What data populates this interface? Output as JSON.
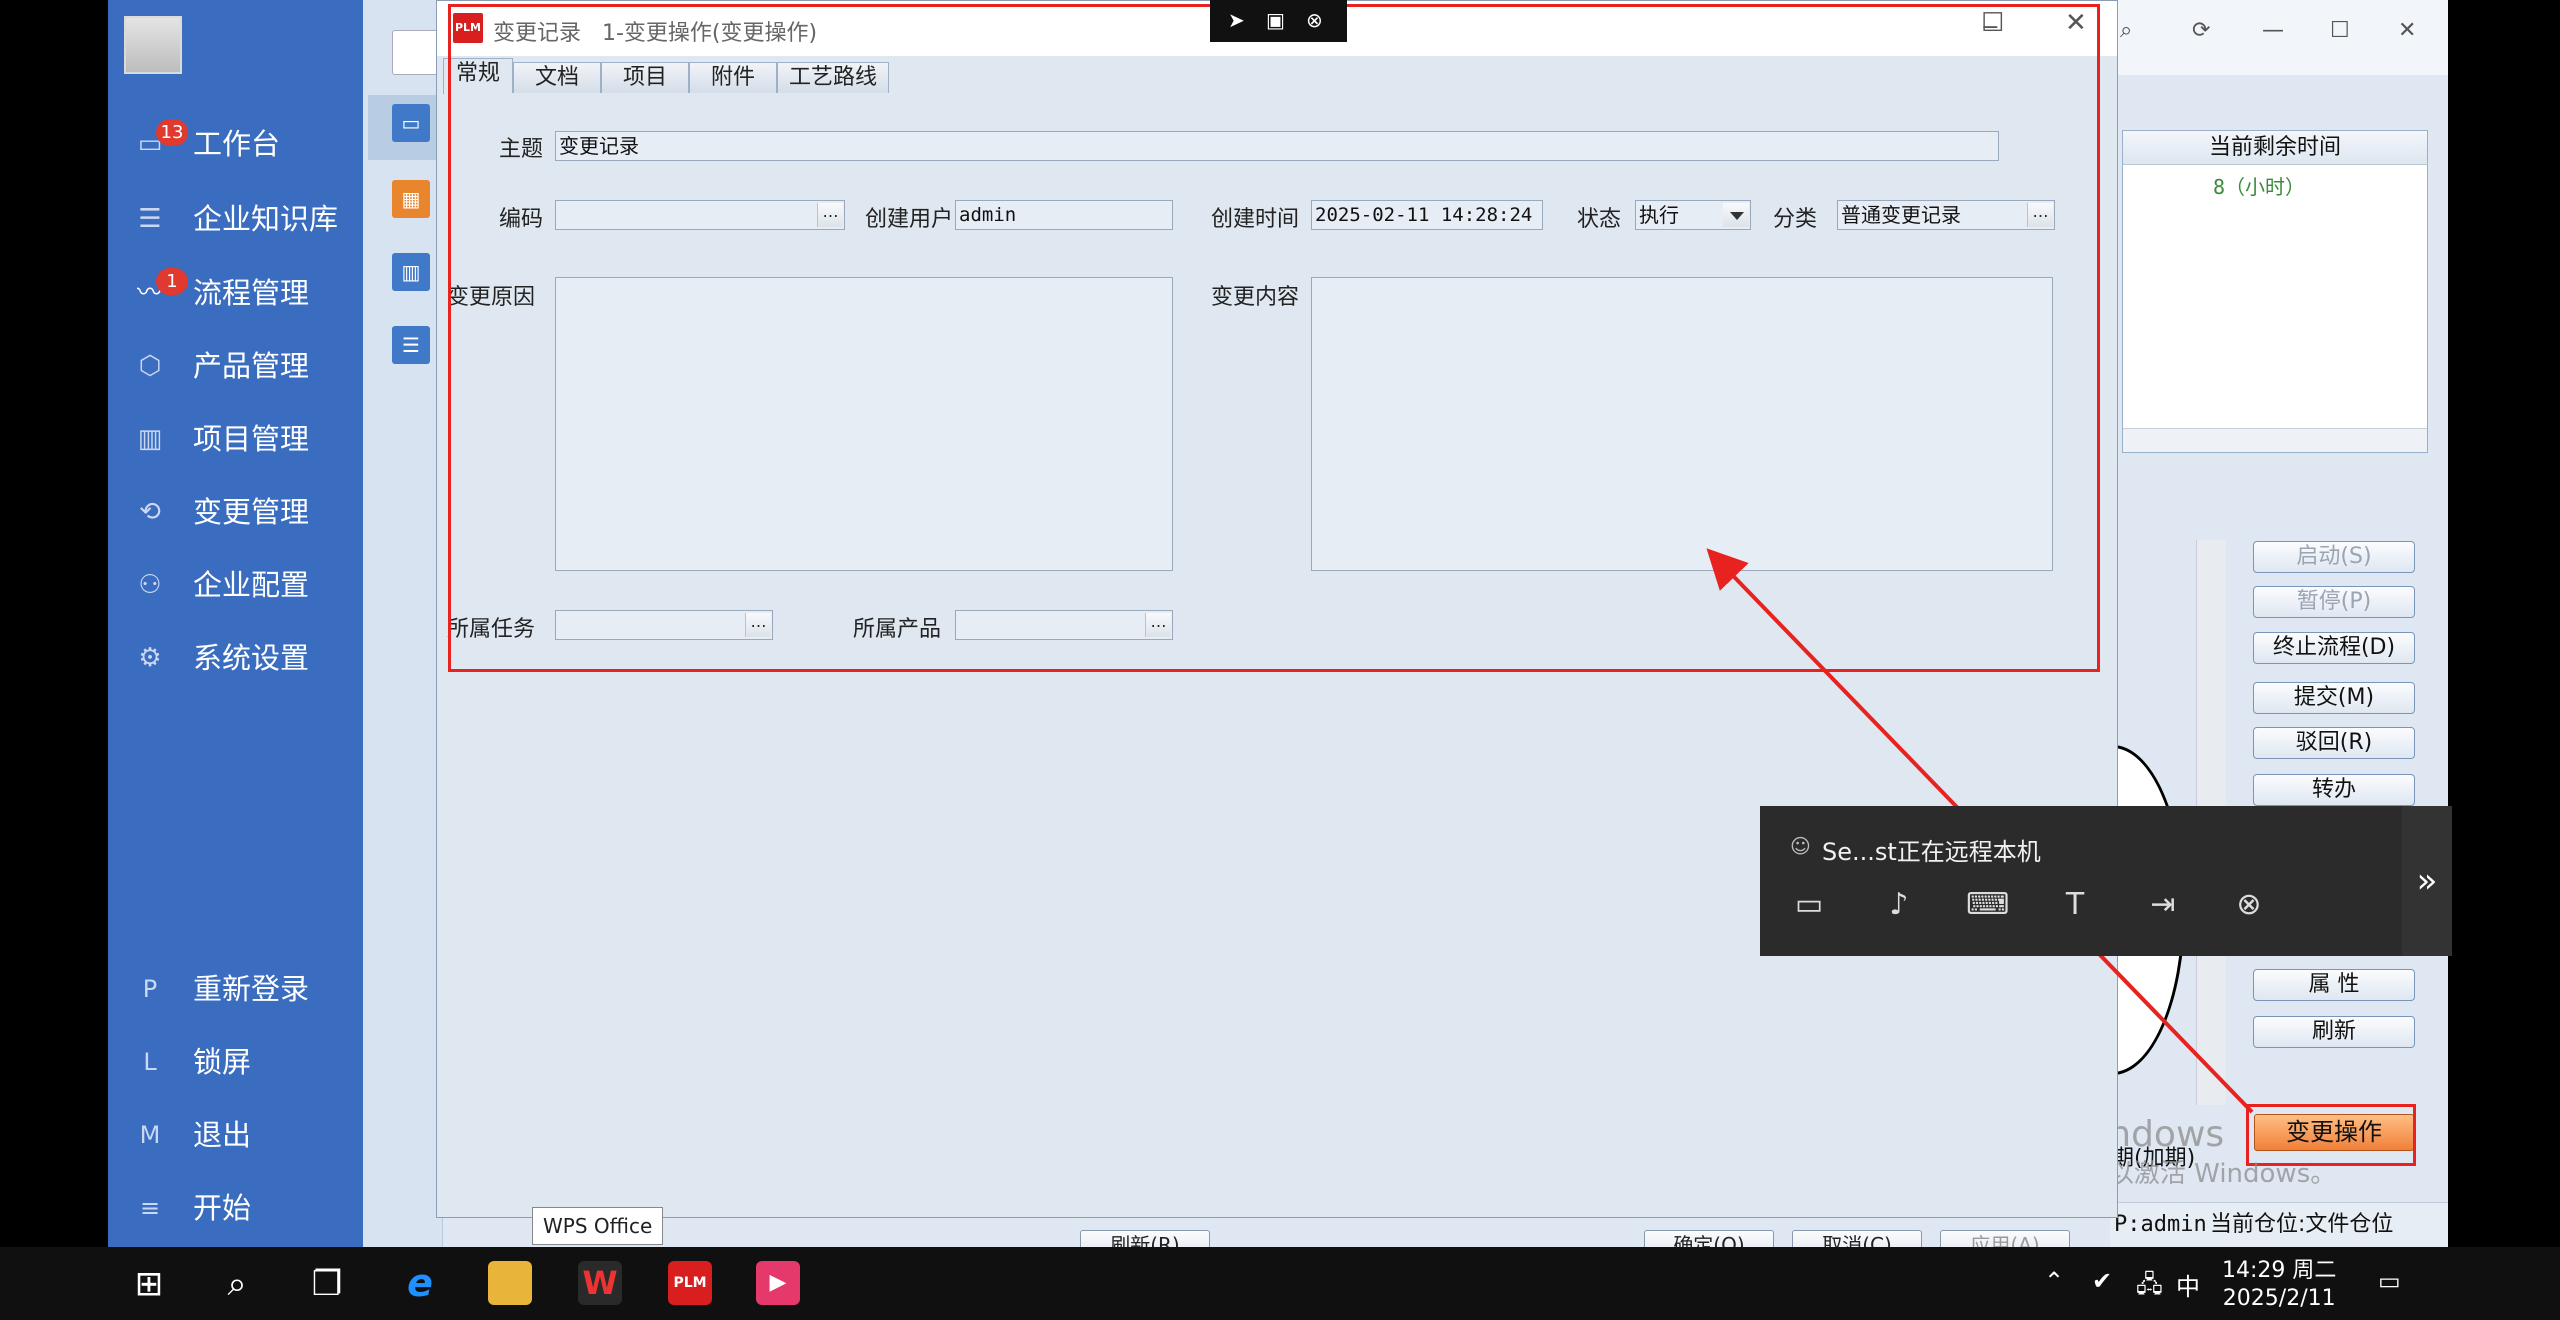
{
  "sidebar": {
    "items": [
      {
        "label": "工作台",
        "badge": "13",
        "icon": "monitor-icon"
      },
      {
        "label": "企业知识库",
        "icon": "book-icon"
      },
      {
        "label": "流程管理",
        "badge": "1",
        "icon": "flow-icon"
      },
      {
        "label": "产品管理",
        "icon": "box-icon"
      },
      {
        "label": "项目管理",
        "icon": "chart-icon"
      },
      {
        "label": "变更管理",
        "icon": "change-icon"
      },
      {
        "label": "企业配置",
        "icon": "users-icon"
      },
      {
        "label": "系统设置",
        "icon": "gear-icon"
      }
    ],
    "bottom": [
      {
        "key": "P",
        "label": "重新登录"
      },
      {
        "key": "L",
        "label": "锁屏"
      },
      {
        "key": "M",
        "label": "退出"
      },
      {
        "key": "≡",
        "label": "开始"
      }
    ]
  },
  "dialog": {
    "logo": "PLM",
    "title": "变更记录",
    "subtitle": "1-变更操作(变更操作)",
    "tabs": [
      "常规",
      "文档",
      "项目",
      "附件",
      "工艺路线"
    ],
    "fields": {
      "subject_label": "主题",
      "subject_value": "变更记录",
      "code_label": "编码",
      "code_value": "",
      "creator_label": "创建用户",
      "creator_value": "admin",
      "created_label": "创建时间",
      "created_value": "2025-02-11 14:28:24",
      "status_label": "状态",
      "status_value": "执行",
      "category_label": "分类",
      "category_value": "普通变更记录",
      "reason_label": "变更原因",
      "content_label": "变更内容",
      "task_label": "所属任务",
      "product_label": "所属产品"
    },
    "bottom_buttons": [
      "刷新(R)",
      "确定(O)",
      "取消(C)",
      "应用(A)"
    ]
  },
  "background": {
    "table_header": "当前剩余时间",
    "table_value": "8（小时）",
    "buttons": [
      "启动(S)",
      "暂停(P)",
      "终止流程(D)",
      "提交(M)",
      "驳回(R)",
      "转办",
      "属  性",
      "刷新"
    ],
    "disabled_buttons": [
      0,
      1
    ],
    "change_button": "变更操作",
    "date_fragment": "期(加期)",
    "status_user": "P:admin",
    "status_place": "当前仓位:文件仓位",
    "watermark_line1": "激活 Windows",
    "watermark_line2": "转到\"设置\"以激活 Windows。"
  },
  "remote": {
    "status_text": "Se...st正在远程本机"
  },
  "tooltip": "WPS Office",
  "taskbar": {
    "time": "14:29 周二",
    "date": "2025/2/11",
    "ime": "中",
    "apps": [
      {
        "name": "ie",
        "label": "e"
      },
      {
        "name": "explorer",
        "label": ""
      },
      {
        "name": "wps",
        "label": "W"
      },
      {
        "name": "plm",
        "label": "PLM"
      },
      {
        "name": "kuaizhi",
        "label": "▶"
      }
    ]
  },
  "colors": {
    "sidebar": "#3a6cc0",
    "highlight_red": "#e8231f",
    "change_button": "#f0803a"
  }
}
